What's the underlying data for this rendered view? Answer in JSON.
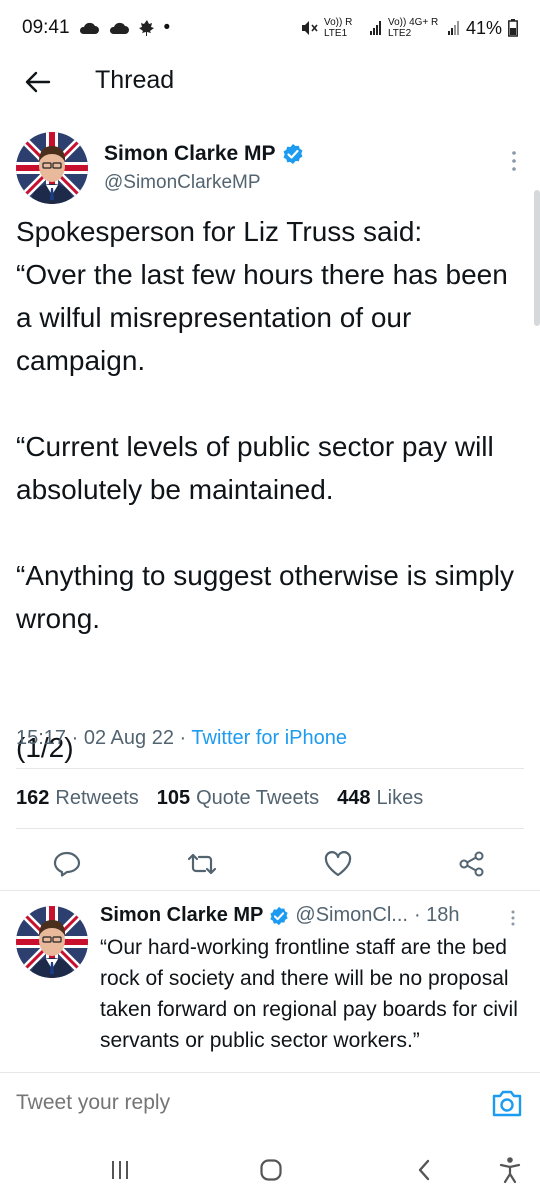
{
  "status_bar": {
    "time": "09:41",
    "dot": "•",
    "sim1_label": "Vo)) R LTE1",
    "sim2_label": "Vo)) 4G+ R LTE2",
    "battery_pct": "41%"
  },
  "header": {
    "title": "Thread",
    "back_icon": "arrow-left-icon"
  },
  "main_tweet": {
    "author_name": "Simon Clarke MP",
    "handle": "@SimonClarkeMP",
    "verified": true,
    "text": "Spokesperson for Liz Truss said:\n“Over the last few hours there has been a wilful misrepresentation of our campaign.\n\n“Current levels of public sector pay will absolutely be maintained.\n\n“Anything to suggest otherwise is simply wrong.\n\n\n(1/2)",
    "time": "15:17",
    "date": "02 Aug 22",
    "separator": "·",
    "source": "Twitter for iPhone",
    "stats": {
      "retweets_count": "162",
      "retweets_label": "Retweets",
      "quotes_count": "105",
      "quotes_label": "Quote Tweets",
      "likes_count": "448",
      "likes_label": "Likes"
    },
    "actions": [
      "reply-icon",
      "retweet-icon",
      "like-icon",
      "share-icon"
    ]
  },
  "reply_tweet": {
    "author_name": "Simon Clarke MP",
    "handle": "@SimonCl...",
    "time_ago": "· 18h",
    "text": "“Our hard-working frontline staff are the bed rock of society and there will be no proposal taken forward on regional pay boards for civil servants or public sector workers.”"
  },
  "reply_bar": {
    "placeholder": "Tweet your reply",
    "camera_icon": "camera-icon"
  },
  "nav_bar": [
    "recent-apps-icon",
    "home-icon",
    "back-icon",
    "accessibility-icon"
  ],
  "colors": {
    "accent": "#1d9bf0",
    "text": "#0f1419",
    "secondary": "#536471"
  }
}
